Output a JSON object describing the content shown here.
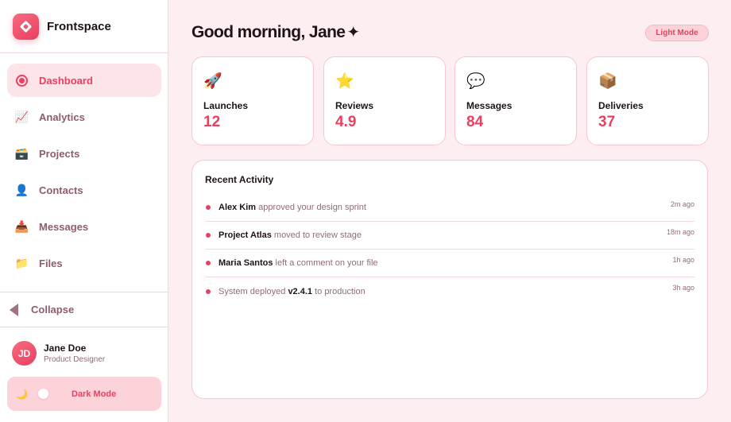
{
  "brand": {
    "name": "Frontspace"
  },
  "nav": {
    "items": [
      {
        "label": "Dashboard",
        "icon": "target-icon",
        "active": true
      },
      {
        "label": "Analytics",
        "icon": "chart-increasing-icon",
        "glyph": "📈"
      },
      {
        "label": "Projects",
        "icon": "file-box-icon",
        "glyph": "🗃️"
      },
      {
        "label": "Contacts",
        "icon": "person-icon",
        "glyph": "👤"
      },
      {
        "label": "Messages",
        "icon": "inbox-tray-icon",
        "glyph": "📥"
      },
      {
        "label": "Files",
        "icon": "folder-icon",
        "glyph": "📁"
      }
    ]
  },
  "collapse": {
    "label": "Collapse",
    "icon": "triangle-left-icon"
  },
  "profile": {
    "initials": "JD",
    "name": "Jane Doe",
    "role": "Product Designer"
  },
  "dark_mode": {
    "icon": "crescent-moon-icon",
    "glyph": "🌙",
    "label": "Dark Mode",
    "enabled": false
  },
  "header": {
    "greeting": "Good morning, Jane",
    "sparkle": "✦",
    "mode_label": "Light Mode"
  },
  "stats": [
    {
      "label": "Launches",
      "value": "12",
      "icon": "rocket-icon",
      "glyph": "🚀"
    },
    {
      "label": "Reviews",
      "value": "4.9",
      "icon": "star-icon",
      "glyph": "⭐"
    },
    {
      "label": "Messages",
      "value": "84",
      "icon": "speech-balloon-icon",
      "glyph": "💬"
    },
    {
      "label": "Deliveries",
      "value": "37",
      "icon": "package-icon",
      "glyph": "📦"
    }
  ],
  "activity": {
    "title": "Recent Activity",
    "items": [
      {
        "strong": "Alex Kim",
        "rest": " approved your design sprint",
        "time": "2m ago"
      },
      {
        "strong": "Project Atlas",
        "rest": " moved to review stage",
        "time": "18m ago"
      },
      {
        "strong": "Maria Santos",
        "rest": " left a comment on your file",
        "time": "1h ago"
      },
      {
        "pre": "System deployed ",
        "strong": "v2.4.1",
        "rest": " to production",
        "time": "3h ago"
      }
    ]
  },
  "colors": {
    "accent": "#e8405f",
    "background": "#fdeef1",
    "active_nav_bg": "#fde4e9",
    "muted_text": "#8f5d6a"
  }
}
